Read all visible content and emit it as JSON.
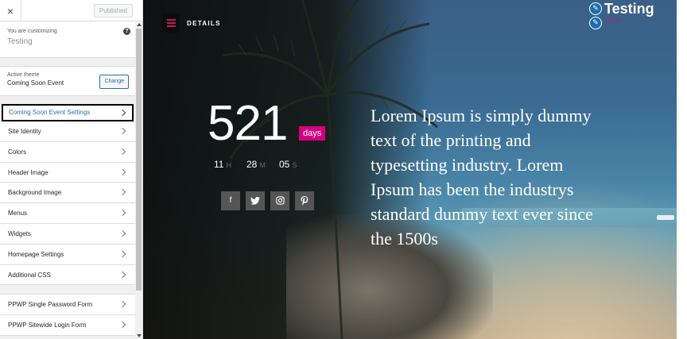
{
  "topbar": {
    "close_icon": "×",
    "published_label": "Published"
  },
  "info": {
    "customizing_label": "You are customizing",
    "site_name": "Testing",
    "help_icon": "?"
  },
  "theme": {
    "label": "Active theme",
    "name": "Coming Soon Event",
    "change_label": "Change"
  },
  "menu": {
    "active": "Coming Soon Event Settings",
    "items": [
      "Site Identity",
      "Colors",
      "Header Image",
      "Background Image",
      "Menus",
      "Widgets",
      "Homepage Settings",
      "Additional CSS"
    ],
    "extra": [
      "PPWP Single Password Form",
      "PPWP Sitewide Login Form"
    ]
  },
  "preview": {
    "details_label": "DETAILS",
    "logo_title": "Testing",
    "logo_tag": "testsite",
    "countdown_days": "521",
    "days_label": "days",
    "hours": "11",
    "hours_unit": "H",
    "minutes": "28",
    "minutes_unit": "M",
    "seconds": "05",
    "seconds_unit": "S",
    "social_icons": [
      "facebook-icon",
      "twitter-icon",
      "instagram-icon",
      "pinterest-icon"
    ],
    "lorem": "Lorem Ipsum is simply dummy text of the printing and typesetting industry. Lorem Ipsum has been the industrys standard dummy text ever since the 1500s"
  },
  "colors": {
    "accent": "#d6007f",
    "link": "#2271b1"
  }
}
